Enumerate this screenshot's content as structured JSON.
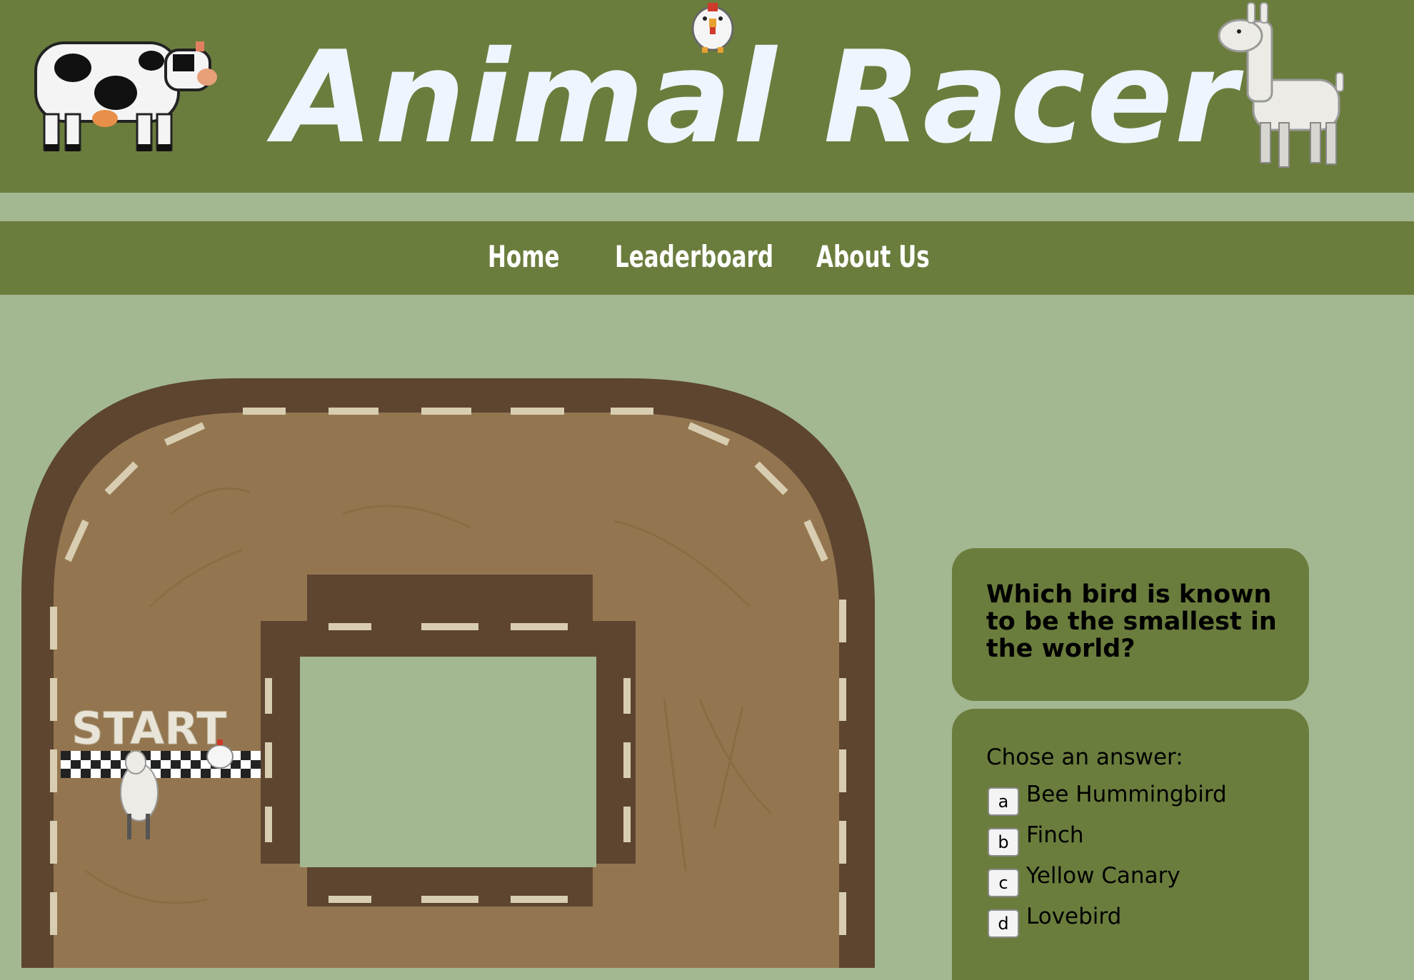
{
  "header": {
    "title": "Animal Racer",
    "logo_sprites": [
      "cow-icon",
      "chicken-icon",
      "llama-icon"
    ]
  },
  "nav": {
    "items": [
      {
        "label": "Home"
      },
      {
        "label": "Leaderboard"
      },
      {
        "label": "About Us"
      }
    ]
  },
  "track": {
    "start_label": "START",
    "racers": [
      "llama-icon",
      "chicken-icon"
    ]
  },
  "quiz": {
    "question": "Which bird is known to be the smallest in the world?",
    "prompt": "Chose an answer:",
    "options": [
      {
        "key": "a",
        "label": "Bee Hummingbird"
      },
      {
        "key": "b",
        "label": "Finch"
      },
      {
        "key": "c",
        "label": "Yellow Canary"
      },
      {
        "key": "d",
        "label": "Lovebird"
      }
    ]
  },
  "colors": {
    "header_bg": "#6b7d3d",
    "page_bg": "#a3b891",
    "title_text": "#eef5ff",
    "track_dirt": "#937650",
    "track_border": "#5d4530"
  }
}
